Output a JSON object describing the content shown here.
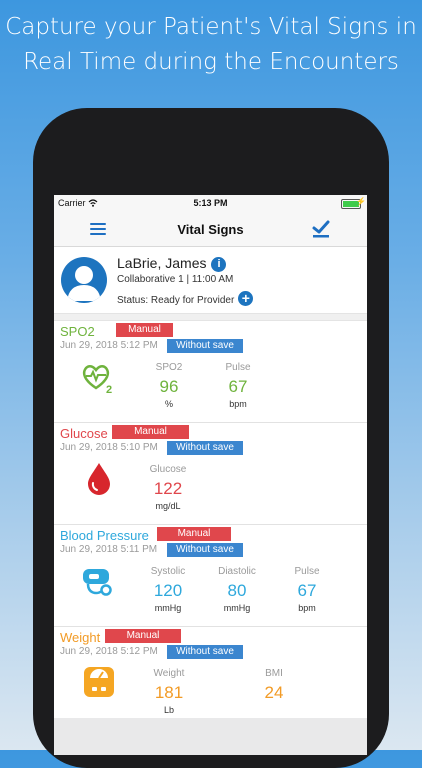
{
  "headline": {
    "line1": "Capture your Patient's Vital Signs in",
    "line2": "Real Time during the Encounters"
  },
  "status_bar": {
    "carrier": "Carrier",
    "time": "5:13 PM"
  },
  "nav": {
    "title": "Vital Signs",
    "menu_icon": "hamburger-icon",
    "check_icon": "checkmark-icon",
    "accent": "#1e6fc2"
  },
  "patient": {
    "name": "LaBrie, James",
    "location": "Collaborative 1 | 11:00 AM",
    "status": "Status: Ready for Provider",
    "info_glyph": "i",
    "add_glyph": "+"
  },
  "vitals": [
    {
      "title": "SPO2",
      "color": "#6fb33d",
      "manual": "Manual",
      "timestamp": "Jun 29, 2018 5:12 PM",
      "badge": "Without save",
      "icon": "heart-o2-icon",
      "values": [
        {
          "label": "SPO2",
          "value": "96",
          "unit": "%"
        },
        {
          "label": "Pulse",
          "value": "67",
          "unit": "bpm"
        }
      ]
    },
    {
      "title": "Glucose",
      "color": "#e0474c",
      "manual": "Manual",
      "timestamp": "Jun 29, 2018 5:10 PM",
      "badge": "Without save",
      "icon": "blood-drop-icon",
      "values": [
        {
          "label": "Glucose",
          "value": "122",
          "unit": "mg/dL"
        }
      ]
    },
    {
      "title": "Blood Pressure",
      "color": "#2ea8dc",
      "manual": "Manual",
      "timestamp": "Jun 29, 2018 5:11 PM",
      "badge": "Without save",
      "icon": "blood-pressure-cuff-icon",
      "values": [
        {
          "label": "Systolic",
          "value": "120",
          "unit": "mmHg"
        },
        {
          "label": "Diastolic",
          "value": "80",
          "unit": "mmHg"
        },
        {
          "label": "Pulse",
          "value": "67",
          "unit": "bpm"
        }
      ]
    },
    {
      "title": "Weight",
      "color": "#f29b26",
      "manual": "Manual",
      "timestamp": "Jun 29, 2018 5:12 PM",
      "badge": "Without save",
      "icon": "scale-icon",
      "values": [
        {
          "label": "Weight",
          "value": "181",
          "unit": "Lb"
        },
        {
          "label": "BMI",
          "value": "24",
          "unit": ""
        }
      ]
    }
  ]
}
